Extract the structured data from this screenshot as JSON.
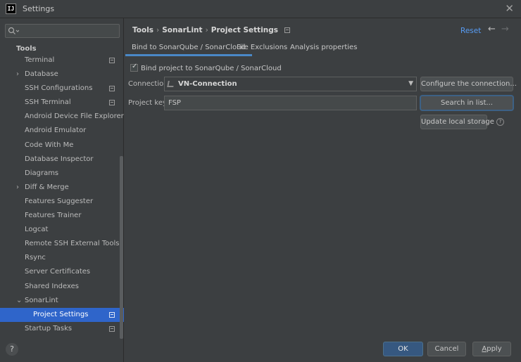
{
  "window": {
    "title": "Settings",
    "app_icon_text": "IJ"
  },
  "sidebar": {
    "search_placeholder": "",
    "section_title": "Tools",
    "items": [
      {
        "label": "Terminal",
        "expandable": false,
        "project_icon": true
      },
      {
        "label": "Database",
        "expandable": true,
        "project_icon": false
      },
      {
        "label": "SSH Configurations",
        "expandable": false,
        "project_icon": true
      },
      {
        "label": "SSH Terminal",
        "expandable": false,
        "project_icon": true
      },
      {
        "label": "Android Device File Explorer",
        "expandable": false,
        "project_icon": false
      },
      {
        "label": "Android Emulator",
        "expandable": false,
        "project_icon": false
      },
      {
        "label": "Code With Me",
        "expandable": false,
        "project_icon": false
      },
      {
        "label": "Database Inspector",
        "expandable": false,
        "project_icon": false
      },
      {
        "label": "Diagrams",
        "expandable": false,
        "project_icon": false
      },
      {
        "label": "Diff & Merge",
        "expandable": true,
        "project_icon": false
      },
      {
        "label": "Features Suggester",
        "expandable": false,
        "project_icon": false
      },
      {
        "label": "Features Trainer",
        "expandable": false,
        "project_icon": false
      },
      {
        "label": "Logcat",
        "expandable": false,
        "project_icon": false
      },
      {
        "label": "Remote SSH External Tools",
        "expandable": false,
        "project_icon": false
      },
      {
        "label": "Rsync",
        "expandable": false,
        "project_icon": false
      },
      {
        "label": "Server Certificates",
        "expandable": false,
        "project_icon": false
      },
      {
        "label": "Shared Indexes",
        "expandable": false,
        "project_icon": false
      },
      {
        "label": "SonarLint",
        "expanded": true,
        "project_icon": false
      },
      {
        "label": "Project Settings",
        "child": true,
        "selected": true,
        "project_icon": true
      },
      {
        "label": "Startup Tasks",
        "expandable": false,
        "project_icon": true
      }
    ],
    "help_label": "?"
  },
  "header": {
    "breadcrumb": [
      "Tools",
      "SonarLint",
      "Project Settings"
    ],
    "breadcrumb_separator": "›",
    "reset_label": "Reset"
  },
  "tabs": [
    {
      "label": "Bind to SonarQube / SonarCloud",
      "active": true
    },
    {
      "label": "File Exclusions",
      "active": false
    },
    {
      "label": "Analysis properties",
      "active": false
    }
  ],
  "binding": {
    "checkbox_label": "Bind project to SonarQube / SonarCloud",
    "checked": true,
    "connection_label": "Connection:",
    "connection_value": "VN-Connection",
    "project_key_label": "Project key:",
    "project_key_value": "FSP",
    "configure_button": "Configure the connection...",
    "search_button": "Search in list...",
    "update_button": "Update local storage"
  },
  "footer": {
    "ok": "OK",
    "cancel": "Cancel",
    "apply": "Apply"
  },
  "colors": {
    "accent": "#2f65ca",
    "link": "#589df6",
    "ok_button": "#365880",
    "background": "#3c3f41"
  },
  "icons": [
    "app-icon",
    "close-icon",
    "search-icon",
    "project-level-icon",
    "chevron-right-icon",
    "chevron-down-icon",
    "back-arrow-icon",
    "forward-arrow-icon",
    "plug-icon",
    "info-icon",
    "help-icon"
  ]
}
